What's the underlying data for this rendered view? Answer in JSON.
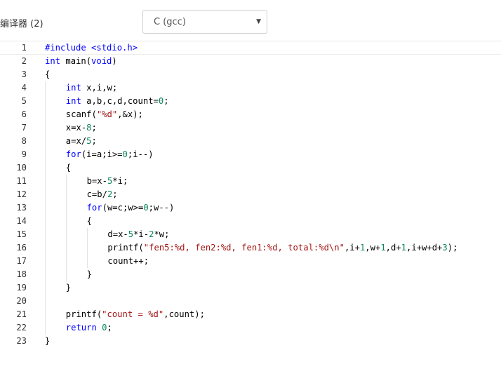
{
  "toolbar": {
    "compiler_label": "编译器 (2)",
    "compiler_select": {
      "value": "C (gcc)"
    }
  },
  "editor": {
    "lines": [
      {
        "n": "1",
        "indent": 0,
        "tokens": [
          [
            "pp",
            "#include <stdio.h>"
          ]
        ]
      },
      {
        "n": "2",
        "indent": 0,
        "tokens": [
          [
            "kw",
            "int"
          ],
          [
            "plain",
            " main("
          ],
          [
            "kw",
            "void"
          ],
          [
            "plain",
            ")"
          ]
        ]
      },
      {
        "n": "3",
        "indent": 0,
        "tokens": [
          [
            "plain",
            "{"
          ]
        ]
      },
      {
        "n": "4",
        "indent": 1,
        "tokens": [
          [
            "kw",
            "int"
          ],
          [
            "plain",
            " x,i,w;"
          ]
        ]
      },
      {
        "n": "5",
        "indent": 1,
        "tokens": [
          [
            "kw",
            "int"
          ],
          [
            "plain",
            " a,b,c,d,count="
          ],
          [
            "num",
            "0"
          ],
          [
            "plain",
            ";"
          ]
        ]
      },
      {
        "n": "6",
        "indent": 1,
        "tokens": [
          [
            "plain",
            "scanf("
          ],
          [
            "str",
            "\"%d\""
          ],
          [
            "plain",
            ",&x);"
          ]
        ]
      },
      {
        "n": "7",
        "indent": 1,
        "tokens": [
          [
            "plain",
            "x=x-"
          ],
          [
            "num",
            "8"
          ],
          [
            "plain",
            ";"
          ]
        ]
      },
      {
        "n": "8",
        "indent": 1,
        "tokens": [
          [
            "plain",
            "a=x/"
          ],
          [
            "num",
            "5"
          ],
          [
            "plain",
            ";"
          ]
        ]
      },
      {
        "n": "9",
        "indent": 1,
        "tokens": [
          [
            "kw",
            "for"
          ],
          [
            "plain",
            "(i=a;i>="
          ],
          [
            "num",
            "0"
          ],
          [
            "plain",
            ";i--)"
          ]
        ]
      },
      {
        "n": "10",
        "indent": 1,
        "tokens": [
          [
            "plain",
            "{"
          ]
        ]
      },
      {
        "n": "11",
        "indent": 2,
        "tokens": [
          [
            "plain",
            "b=x-"
          ],
          [
            "num",
            "5"
          ],
          [
            "plain",
            "*i;"
          ]
        ]
      },
      {
        "n": "12",
        "indent": 2,
        "tokens": [
          [
            "plain",
            "c=b/"
          ],
          [
            "num",
            "2"
          ],
          [
            "plain",
            ";"
          ]
        ]
      },
      {
        "n": "13",
        "indent": 2,
        "tokens": [
          [
            "kw",
            "for"
          ],
          [
            "plain",
            "(w=c;w>="
          ],
          [
            "num",
            "0"
          ],
          [
            "plain",
            ";w--)"
          ]
        ]
      },
      {
        "n": "14",
        "indent": 2,
        "tokens": [
          [
            "plain",
            "{"
          ]
        ]
      },
      {
        "n": "15",
        "indent": 3,
        "tokens": [
          [
            "plain",
            "d=x-"
          ],
          [
            "num",
            "5"
          ],
          [
            "plain",
            "*i-"
          ],
          [
            "num",
            "2"
          ],
          [
            "plain",
            "*w;"
          ]
        ]
      },
      {
        "n": "16",
        "indent": 3,
        "tokens": [
          [
            "plain",
            "printf("
          ],
          [
            "str",
            "\"fen5:%d, fen2:%d, fen1:%d, total:%d\\n\""
          ],
          [
            "plain",
            ",i+"
          ],
          [
            "num",
            "1"
          ],
          [
            "plain",
            ",w+"
          ],
          [
            "num",
            "1"
          ],
          [
            "plain",
            ",d+"
          ],
          [
            "num",
            "1"
          ],
          [
            "plain",
            ",i+w+d+"
          ],
          [
            "num",
            "3"
          ],
          [
            "plain",
            ");"
          ]
        ]
      },
      {
        "n": "17",
        "indent": 3,
        "tokens": [
          [
            "plain",
            "count++;"
          ]
        ]
      },
      {
        "n": "18",
        "indent": 2,
        "tokens": [
          [
            "plain",
            "}"
          ]
        ]
      },
      {
        "n": "19",
        "indent": 1,
        "tokens": [
          [
            "plain",
            "}"
          ]
        ]
      },
      {
        "n": "20",
        "indent": 0,
        "tokens": []
      },
      {
        "n": "21",
        "indent": 1,
        "tokens": [
          [
            "plain",
            "printf("
          ],
          [
            "str",
            "\"count = %d\""
          ],
          [
            "plain",
            ",count);"
          ]
        ]
      },
      {
        "n": "22",
        "indent": 1,
        "tokens": [
          [
            "kw",
            "return"
          ],
          [
            "plain",
            " "
          ],
          [
            "num",
            "0"
          ],
          [
            "plain",
            ";"
          ]
        ]
      },
      {
        "n": "23",
        "indent": 0,
        "tokens": [
          [
            "plain",
            "}"
          ]
        ]
      }
    ]
  }
}
